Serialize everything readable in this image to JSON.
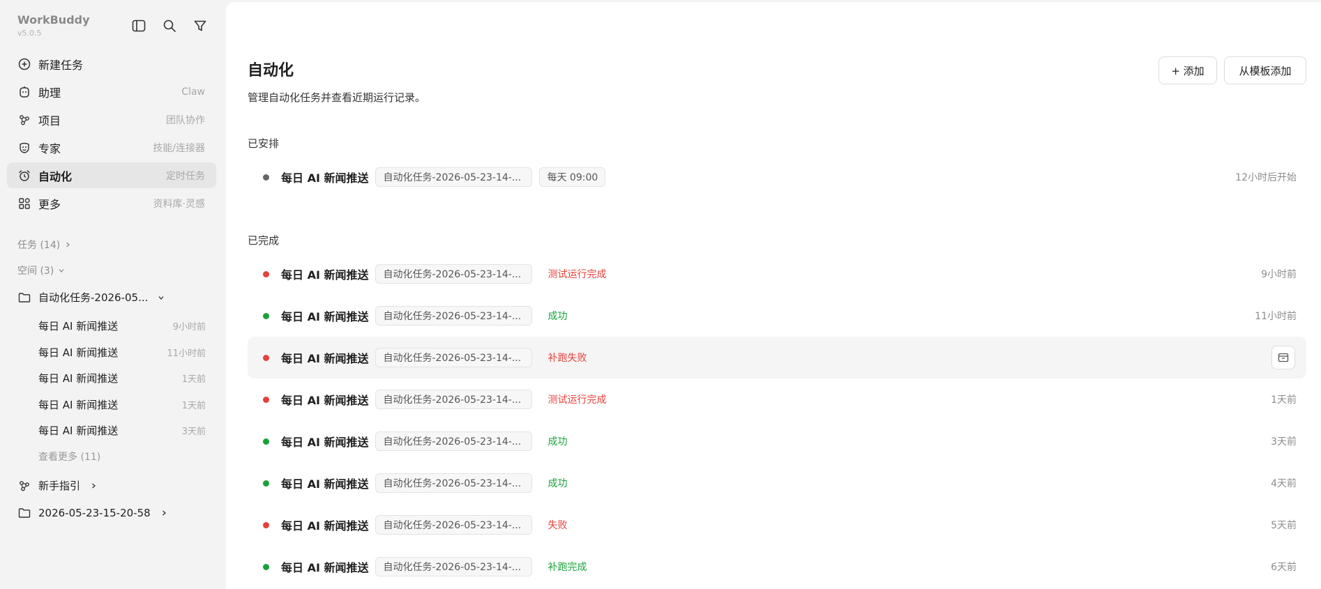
{
  "app": {
    "name": "WorkBuddy",
    "version": "v5.0.5"
  },
  "nav": [
    {
      "label": "新建任务",
      "hint": "",
      "icon": "plus-circle-icon",
      "active": false
    },
    {
      "label": "助理",
      "hint": "Claw",
      "icon": "assistant-icon",
      "active": false
    },
    {
      "label": "项目",
      "hint": "团队协作",
      "icon": "project-icon",
      "active": false
    },
    {
      "label": "专家",
      "hint": "技能/连接器",
      "icon": "expert-icon",
      "active": false
    },
    {
      "label": "自动化",
      "hint": "定时任务",
      "icon": "alarm-clock-icon",
      "active": true
    },
    {
      "label": "更多",
      "hint": "资料库·灵感",
      "icon": "apps-grid-icon",
      "active": false
    }
  ],
  "groups": {
    "tasks_label": "任务 (14)",
    "spaces_label": "空间 (3)"
  },
  "folder": {
    "name": "自动化任务-2026-05...",
    "items": [
      {
        "title": "每日 AI 新闻推送",
        "time": "9小时前"
      },
      {
        "title": "每日 AI 新闻推送",
        "time": "11小时前"
      },
      {
        "title": "每日 AI 新闻推送",
        "time": "1天前"
      },
      {
        "title": "每日 AI 新闻推送",
        "time": "1天前"
      },
      {
        "title": "每日 AI 新闻推送",
        "time": "3天前"
      }
    ],
    "see_more": "查看更多 (11)"
  },
  "guide_label": "新手指引",
  "folder2_label": "2026-05-23-15-20-58",
  "main": {
    "title": "自动化",
    "description": "管理自动化任务并查看近期运行记录。",
    "add_button": "+ 添加",
    "template_button": "从模板添加",
    "scheduled_title": "已安排",
    "completed_title": "已完成",
    "scheduled": [
      {
        "name": "每日 AI 新闻推送",
        "chip": "自动化任务-2026-05-23-14-...",
        "schedule": "每天 09:00",
        "time": "12小时后开始",
        "dot": "#666666"
      }
    ],
    "completed": [
      {
        "name": "每日 AI 新闻推送",
        "chip": "自动化任务-2026-05-23-14-...",
        "status": "测试运行完成",
        "status_color": "red",
        "time": "9小时前",
        "dot": "#e5413b"
      },
      {
        "name": "每日 AI 新闻推送",
        "chip": "自动化任务-2026-05-23-14-...",
        "status": "成功",
        "status_color": "green",
        "time": "11小时前",
        "dot": "#18a23a"
      },
      {
        "name": "每日 AI 新闻推送",
        "chip": "自动化任务-2026-05-23-14-...",
        "status": "补跑失败",
        "status_color": "red",
        "time": "",
        "dot": "#e5413b",
        "hover": true
      },
      {
        "name": "每日 AI 新闻推送",
        "chip": "自动化任务-2026-05-23-14-...",
        "status": "测试运行完成",
        "status_color": "red",
        "time": "1天前",
        "dot": "#e5413b"
      },
      {
        "name": "每日 AI 新闻推送",
        "chip": "自动化任务-2026-05-23-14-...",
        "status": "成功",
        "status_color": "green",
        "time": "3天前",
        "dot": "#18a23a"
      },
      {
        "name": "每日 AI 新闻推送",
        "chip": "自动化任务-2026-05-23-14-...",
        "status": "成功",
        "status_color": "green",
        "time": "4天前",
        "dot": "#18a23a"
      },
      {
        "name": "每日 AI 新闻推送",
        "chip": "自动化任务-2026-05-23-14-...",
        "status": "失败",
        "status_color": "red",
        "time": "5天前",
        "dot": "#e5413b"
      },
      {
        "name": "每日 AI 新闻推送",
        "chip": "自动化任务-2026-05-23-14-...",
        "status": "补跑完成",
        "status_color": "green",
        "time": "6天前",
        "dot": "#18a23a"
      }
    ]
  }
}
